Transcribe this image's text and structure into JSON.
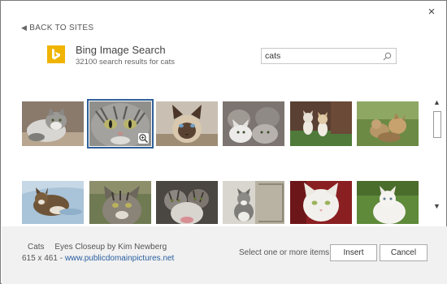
{
  "dialog": {
    "close_label": "×",
    "back_label": "BACK TO SITES"
  },
  "provider": {
    "name": "Bing Image Search",
    "results_summary": "32100 search results for cats",
    "brand_color": "#f0b400"
  },
  "search": {
    "value": "cats",
    "placeholder": ""
  },
  "results": [
    {
      "row": 0,
      "col": 0,
      "subject": "gray and white cat lying down"
    },
    {
      "row": 0,
      "col": 1,
      "subject": "tabby cat face closeup",
      "selected": true
    },
    {
      "row": 0,
      "col": 2,
      "subject": "siamese cat"
    },
    {
      "row": 0,
      "col": 3,
      "subject": "group of kittens"
    },
    {
      "row": 0,
      "col": 4,
      "subject": "two kittens on grass"
    },
    {
      "row": 0,
      "col": 5,
      "subject": "kittens playing outdoors"
    },
    {
      "row": 1,
      "col": 0,
      "subject": "tabby kitten on blue blanket"
    },
    {
      "row": 1,
      "col": 1,
      "subject": "tabby cat outdoors"
    },
    {
      "row": 1,
      "col": 2,
      "subject": "tabby kittens huddled"
    },
    {
      "row": 1,
      "col": 3,
      "subject": "gray kitten on chair"
    },
    {
      "row": 1,
      "col": 4,
      "subject": "white cat on red"
    },
    {
      "row": 1,
      "col": 5,
      "subject": "white cat in grass"
    }
  ],
  "details": {
    "label": "Cats",
    "title": "Eyes Closeup by Kim Newberg",
    "dimensions": "615 x 461",
    "separator": " - ",
    "source": "www.publicdomainpictures.net"
  },
  "footer": {
    "status": "Select one or more items.",
    "insert_label": "Insert",
    "cancel_label": "Cancel"
  },
  "colors": {
    "selection": "#2f5f97",
    "link": "#2a5fa0",
    "footer_bg": "#f1f1f1"
  }
}
